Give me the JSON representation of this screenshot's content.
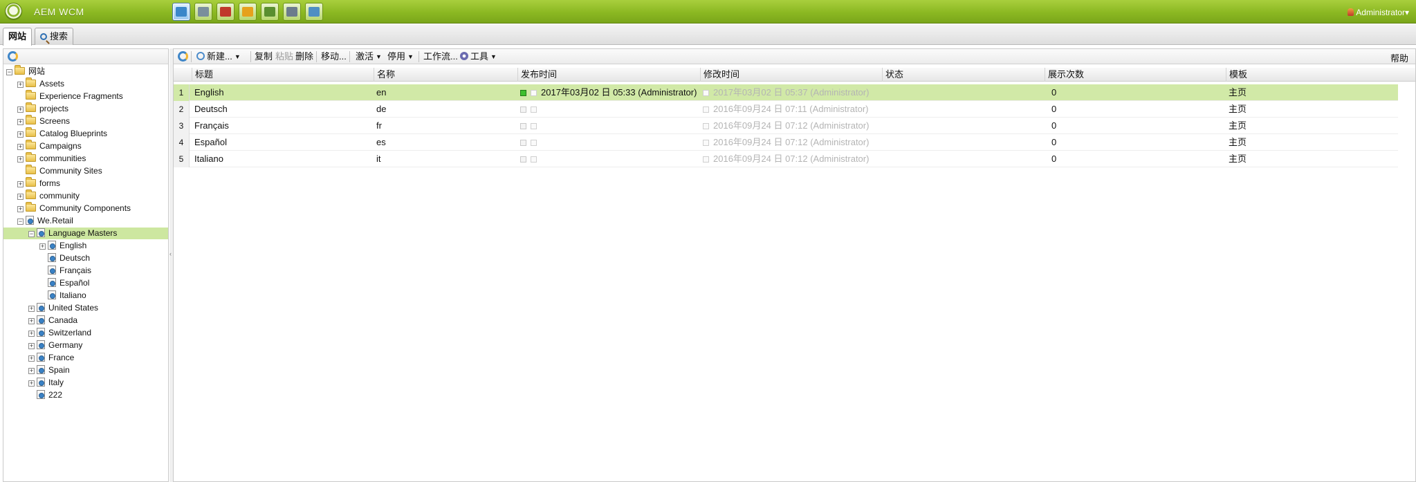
{
  "app": {
    "title": "AEM WCM"
  },
  "top_toolbar": {
    "icons": [
      {
        "name": "websites-icon",
        "color": "#3b87c9",
        "active": true
      },
      {
        "name": "digital-assets-icon",
        "color": "#7a8f9c",
        "active": false
      },
      {
        "name": "campaigns-icon",
        "color": "#c0392b",
        "active": false
      },
      {
        "name": "inbox-icon",
        "color": "#e6a11c",
        "active": false
      },
      {
        "name": "users-icon",
        "color": "#5a8f2f",
        "active": false
      },
      {
        "name": "tools-icon",
        "color": "#6c7c8c",
        "active": false
      },
      {
        "name": "tagging-icon",
        "color": "#4f8fc3",
        "active": false
      }
    ]
  },
  "user_menu": {
    "label": "Administrator"
  },
  "tabs": [
    {
      "label": "网站",
      "active": true
    },
    {
      "label": "搜索",
      "active": false
    }
  ],
  "tree": [
    {
      "label": "网站",
      "depth": 0,
      "icon": "folder",
      "expander": "minus"
    },
    {
      "label": "Assets",
      "depth": 1,
      "icon": "folder",
      "expander": "plus"
    },
    {
      "label": "Experience Fragments",
      "depth": 1,
      "icon": "folder",
      "expander": "none"
    },
    {
      "label": "projects",
      "depth": 1,
      "icon": "folder",
      "expander": "plus"
    },
    {
      "label": "Screens",
      "depth": 1,
      "icon": "folder",
      "expander": "plus"
    },
    {
      "label": "Catalog Blueprints",
      "depth": 1,
      "icon": "folder",
      "expander": "plus"
    },
    {
      "label": "Campaigns",
      "depth": 1,
      "icon": "folder",
      "expander": "plus"
    },
    {
      "label": "communities",
      "depth": 1,
      "icon": "folder",
      "expander": "plus"
    },
    {
      "label": "Community Sites",
      "depth": 1,
      "icon": "folder",
      "expander": "none"
    },
    {
      "label": "forms",
      "depth": 1,
      "icon": "folder",
      "expander": "plus"
    },
    {
      "label": "community",
      "depth": 1,
      "icon": "folder",
      "expander": "plus"
    },
    {
      "label": "Community Components",
      "depth": 1,
      "icon": "folder",
      "expander": "plus"
    },
    {
      "label": "We.Retail",
      "depth": 1,
      "icon": "page",
      "expander": "minus"
    },
    {
      "label": "Language Masters",
      "depth": 2,
      "icon": "page",
      "expander": "minus",
      "selected": true
    },
    {
      "label": "English",
      "depth": 3,
      "icon": "page",
      "expander": "plus"
    },
    {
      "label": "Deutsch",
      "depth": 3,
      "icon": "page",
      "expander": "none"
    },
    {
      "label": "Français",
      "depth": 3,
      "icon": "page",
      "expander": "none"
    },
    {
      "label": "Español",
      "depth": 3,
      "icon": "page",
      "expander": "none"
    },
    {
      "label": "Italiano",
      "depth": 3,
      "icon": "page",
      "expander": "none"
    },
    {
      "label": "United States",
      "depth": 2,
      "icon": "page",
      "expander": "plus"
    },
    {
      "label": "Canada",
      "depth": 2,
      "icon": "page",
      "expander": "plus"
    },
    {
      "label": "Switzerland",
      "depth": 2,
      "icon": "page",
      "expander": "plus"
    },
    {
      "label": "Germany",
      "depth": 2,
      "icon": "page",
      "expander": "plus"
    },
    {
      "label": "France",
      "depth": 2,
      "icon": "page",
      "expander": "plus"
    },
    {
      "label": "Spain",
      "depth": 2,
      "icon": "page",
      "expander": "plus"
    },
    {
      "label": "Italy",
      "depth": 2,
      "icon": "page",
      "expander": "plus"
    },
    {
      "label": "222",
      "depth": 2,
      "icon": "page",
      "expander": "none"
    }
  ],
  "grid_toolbar": {
    "new": "新建...",
    "copy": "复制",
    "paste": "粘贴",
    "delete": "删除",
    "move": "移动...",
    "activate": "激活",
    "deactivate": "停用",
    "workflow": "工作流...",
    "tools": "工具",
    "help": "帮助"
  },
  "grid": {
    "columns": {
      "title": "标题",
      "name": "名称",
      "published": "发布时间",
      "modified": "修改时间",
      "status": "状态",
      "impressions": "展示次数",
      "template": "模板"
    },
    "rows": [
      {
        "num": "1",
        "title": "English",
        "name": "en",
        "published": "2017年03月02 日 05:33 (Administrator)",
        "published_active": true,
        "modified": "2017年03月02 日 05:37 (Administrator)",
        "status": "",
        "impressions": "0",
        "template": "主页",
        "selected": true
      },
      {
        "num": "2",
        "title": "Deutsch",
        "name": "de",
        "published": "",
        "published_active": false,
        "modified": "2016年09月24 日 07:11 (Administrator)",
        "status": "",
        "impressions": "0",
        "template": "主页",
        "selected": false
      },
      {
        "num": "3",
        "title": "Français",
        "name": "fr",
        "published": "",
        "published_active": false,
        "modified": "2016年09月24 日 07:12 (Administrator)",
        "status": "",
        "impressions": "0",
        "template": "主页",
        "selected": false
      },
      {
        "num": "4",
        "title": "Español",
        "name": "es",
        "published": "",
        "published_active": false,
        "modified": "2016年09月24 日 07:12 (Administrator)",
        "status": "",
        "impressions": "0",
        "template": "主页",
        "selected": false
      },
      {
        "num": "5",
        "title": "Italiano",
        "name": "it",
        "published": "",
        "published_active": false,
        "modified": "2016年09月24 日 07:12 (Administrator)",
        "status": "",
        "impressions": "0",
        "template": "主页",
        "selected": false
      }
    ]
  }
}
